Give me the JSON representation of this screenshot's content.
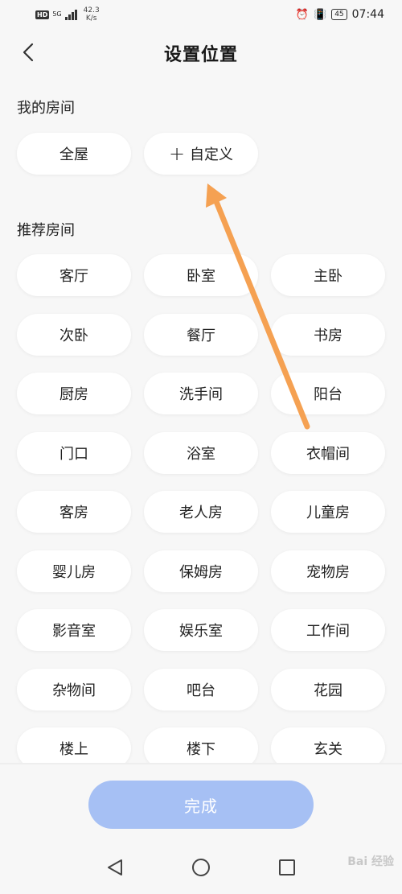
{
  "status": {
    "hd": "HD",
    "net": "5G",
    "speed_value": "42.3",
    "speed_unit": "K/s",
    "battery": "45",
    "time": "07:44"
  },
  "header": {
    "title": "设置位置"
  },
  "my_rooms": {
    "title": "我的房间",
    "items": [
      {
        "label": "全屋"
      },
      {
        "label": "自定义",
        "prefix": "+"
      }
    ]
  },
  "recommended": {
    "title": "推荐房间",
    "items": [
      "客厅",
      "卧室",
      "主卧",
      "次卧",
      "餐厅",
      "书房",
      "厨房",
      "洗手间",
      "阳台",
      "门口",
      "浴室",
      "衣帽间",
      "客房",
      "老人房",
      "儿童房",
      "婴儿房",
      "保姆房",
      "宠物房",
      "影音室",
      "娱乐室",
      "工作间",
      "杂物间",
      "吧台",
      "花园",
      "楼上",
      "楼下",
      "玄关"
    ]
  },
  "footer": {
    "done_label": "完成"
  },
  "colors": {
    "done_bg": "#a6c0f4",
    "annotation_arrow": "#f5a152"
  },
  "watermark": "Bai 经验"
}
